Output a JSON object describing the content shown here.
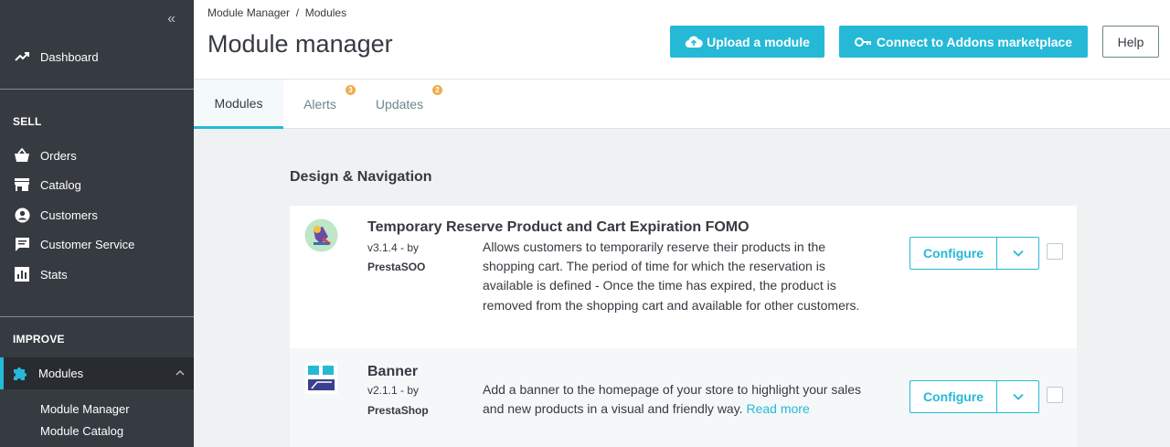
{
  "sidebar": {
    "dashboard": "Dashboard",
    "sell_title": "SELL",
    "sell_items": [
      "Orders",
      "Catalog",
      "Customers",
      "Customer Service",
      "Stats"
    ],
    "improve_title": "IMPROVE",
    "modules": "Modules",
    "sub_items": [
      "Module Manager",
      "Module Catalog"
    ]
  },
  "header": {
    "breadcrumb": "Module Manager  /  Modules",
    "title": "Module manager",
    "upload_label": "Upload a module",
    "connect_label": "Connect to Addons marketplace",
    "help_label": "Help"
  },
  "tabs": [
    {
      "label": "Modules"
    },
    {
      "label": "Alerts",
      "badge": "3"
    },
    {
      "label": "Updates",
      "badge": "2"
    }
  ],
  "content": {
    "section": "Design & Navigation",
    "modules": [
      {
        "name": "Temporary Reserve Product and Cart Expiration FOMO",
        "version": "v3.1.4 - by",
        "author": "PrestaSOO",
        "description": "Allows customers to temporarily reserve their products in the shopping cart. The period of time for which the reservation is available is defined - Once the time has expired, the product is removed from the shopping cart and available for other customers.",
        "configure": "Configure"
      },
      {
        "name": "Banner",
        "version": "v2.1.1 - by",
        "author": "PrestaShop",
        "description": "Add a banner to the homepage of your store to highlight your sales and new products in a visual and friendly way.",
        "read_more": "Read more",
        "configure": "Configure"
      }
    ]
  },
  "colors": {
    "accent": "#25b9d7",
    "sidebar_bg": "#363a41",
    "badge": "#f0ad4e"
  }
}
